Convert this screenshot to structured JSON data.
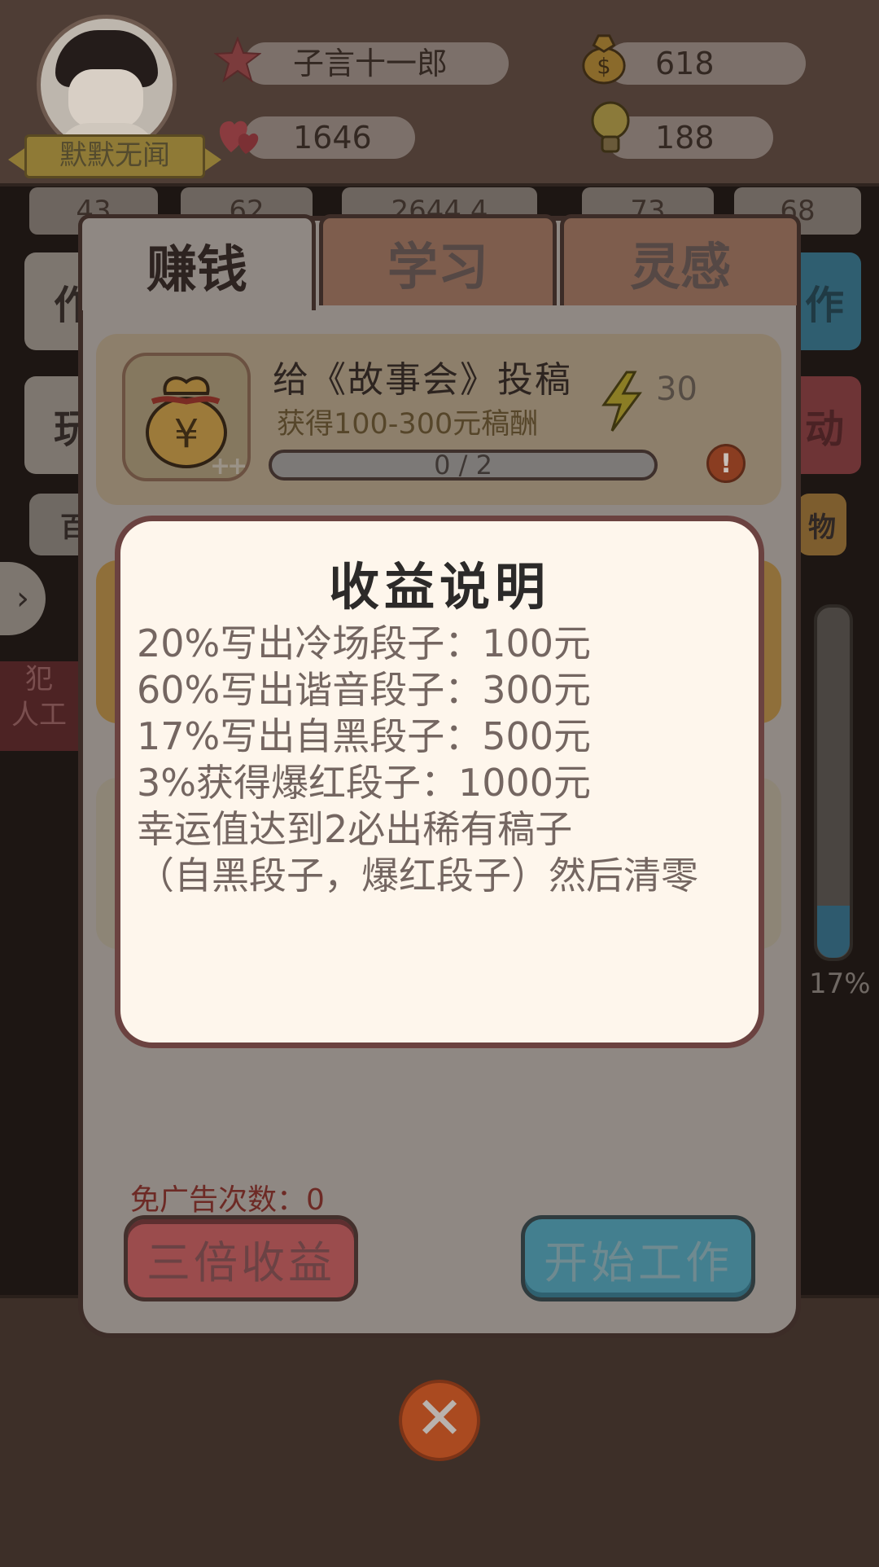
{
  "player": {
    "nickname": "子言十一郎",
    "banner": "默默无闻",
    "money": "618",
    "hearts": "1646",
    "ideas": "188"
  },
  "resources": [
    "43",
    "62",
    "2644.4",
    "73",
    "68"
  ],
  "background_buttons": {
    "left_top": "作",
    "right_top": "作",
    "left_mid": "玩",
    "right_mid": "动",
    "left_small": "百",
    "right_small": "物",
    "side_label_1": "犯",
    "side_label_2": "人工",
    "right_percent": "17%"
  },
  "tabs": [
    {
      "label": "赚钱",
      "active": true
    },
    {
      "label": "学习",
      "active": false
    },
    {
      "label": "灵感",
      "active": false
    }
  ],
  "task": {
    "title": "给《故事会》投稿",
    "subtitle": "获得100-300元稿酬",
    "energy": "30",
    "progress_text": "0 / 2",
    "progress": 0,
    "icon": "money-bag-icon"
  },
  "info_popup": {
    "title": "收益说明",
    "lines": [
      "20%写出冷场段子：100元",
      "60%写出谐音段子：300元",
      "17%写出自黑段子：500元",
      "3%获得爆红段子：1000元",
      "幸运值达到2必出稀有稿子",
      "（自黑段子，爆红段子）然后清零"
    ]
  },
  "ad_free_count": "免广告次数：0",
  "buttons": {
    "triple": "三倍收益",
    "start": "开始工作"
  },
  "colors": {
    "popup_bg": "#fef6ec",
    "popup_border": "#6b4240",
    "triple_button": "#9b4c4d",
    "start_button": "#437f8f",
    "close_button": "#aa4a20"
  }
}
